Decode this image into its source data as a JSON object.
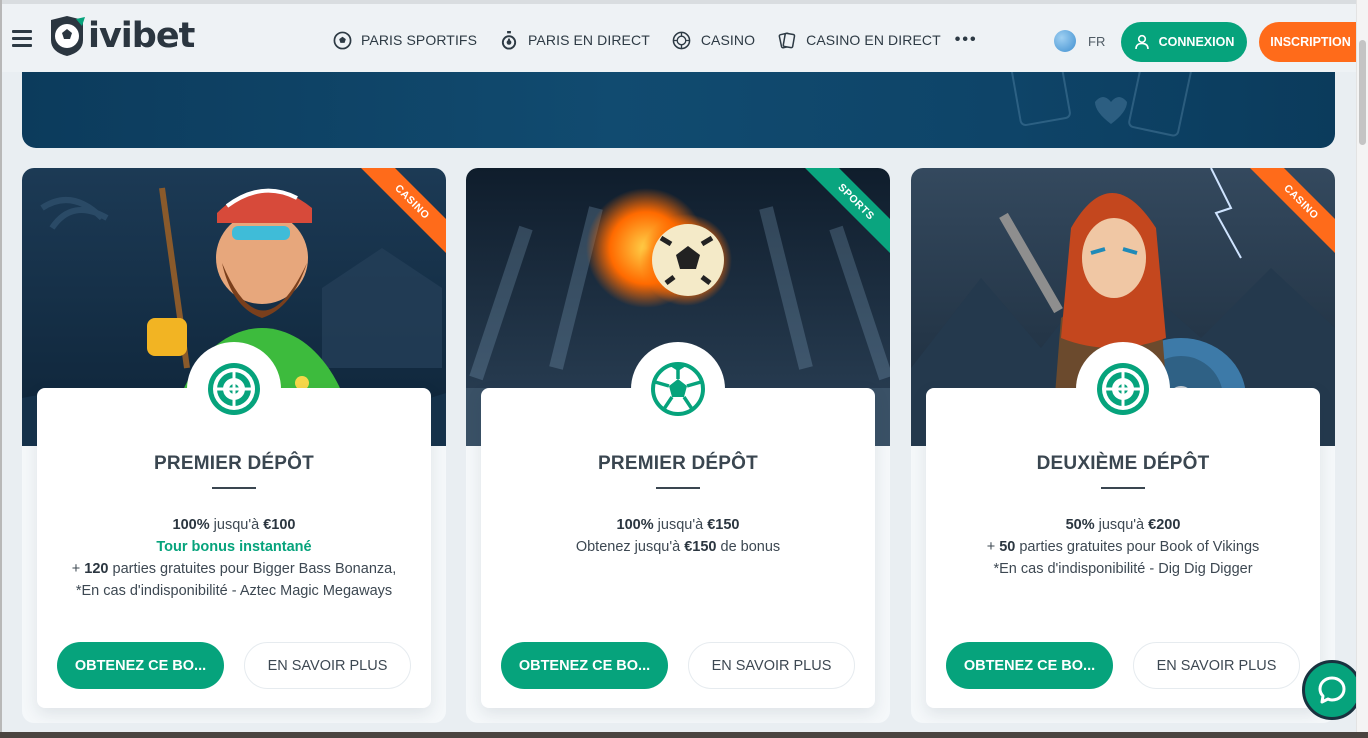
{
  "header": {
    "logo_text": "ivibet",
    "nav": [
      {
        "label": "PARIS SPORTIFS",
        "icon": "soccer-ball-icon"
      },
      {
        "label": "PARIS EN DIRECT",
        "icon": "stopwatch-icon"
      },
      {
        "label": "CASINO",
        "icon": "roulette-icon"
      },
      {
        "label": "CASINO EN DIRECT",
        "icon": "cards-icon"
      }
    ],
    "more_label": "•••",
    "language": "FR",
    "login_label": "CONNEXION",
    "signup_label": "INSCRIPTION"
  },
  "cards": [
    {
      "ribbon": "CASINO",
      "title": "PREMIER DÉPÔT",
      "offer_percent": "100%",
      "offer_upto": "jusqu'à",
      "offer_amount": "€100",
      "highlight": "Tour bonus instantané",
      "spins_prefix": "+",
      "spins_count": "120",
      "spins_text": "parties gratuites pour Bigger Bass Bonanza,",
      "note": "*En cas d'indisponibilité - Aztec Magic Megaways",
      "get_label": "OBTENEZ CE BO...",
      "more_label": "EN SAVOIR PLUS"
    },
    {
      "ribbon": "SPORTS",
      "title": "PREMIER DÉPÔT",
      "offer_percent": "100%",
      "offer_upto": "jusqu'à",
      "offer_amount": "€150",
      "line2_prefix": "Obtenez jusqu'à",
      "line2_amount": "€150",
      "line2_suffix": "de bonus",
      "get_label": "OBTENEZ CE BO...",
      "more_label": "EN SAVOIR PLUS"
    },
    {
      "ribbon": "CASINO",
      "title": "DEUXIÈME DÉPÔT",
      "offer_percent": "50%",
      "offer_upto": "jusqu'à",
      "offer_amount": "€200",
      "spins_prefix": "+",
      "spins_count": "50",
      "spins_text": "parties gratuites pour Book of Vikings",
      "note": "*En cas d'indisponibilité - Dig Dig Digger",
      "get_label": "OBTENEZ CE BO...",
      "more_label": "EN SAVOIR PLUS"
    }
  ],
  "colors": {
    "accent": "#06a37c",
    "orange": "#ff6b1a",
    "text": "#3a4650"
  }
}
